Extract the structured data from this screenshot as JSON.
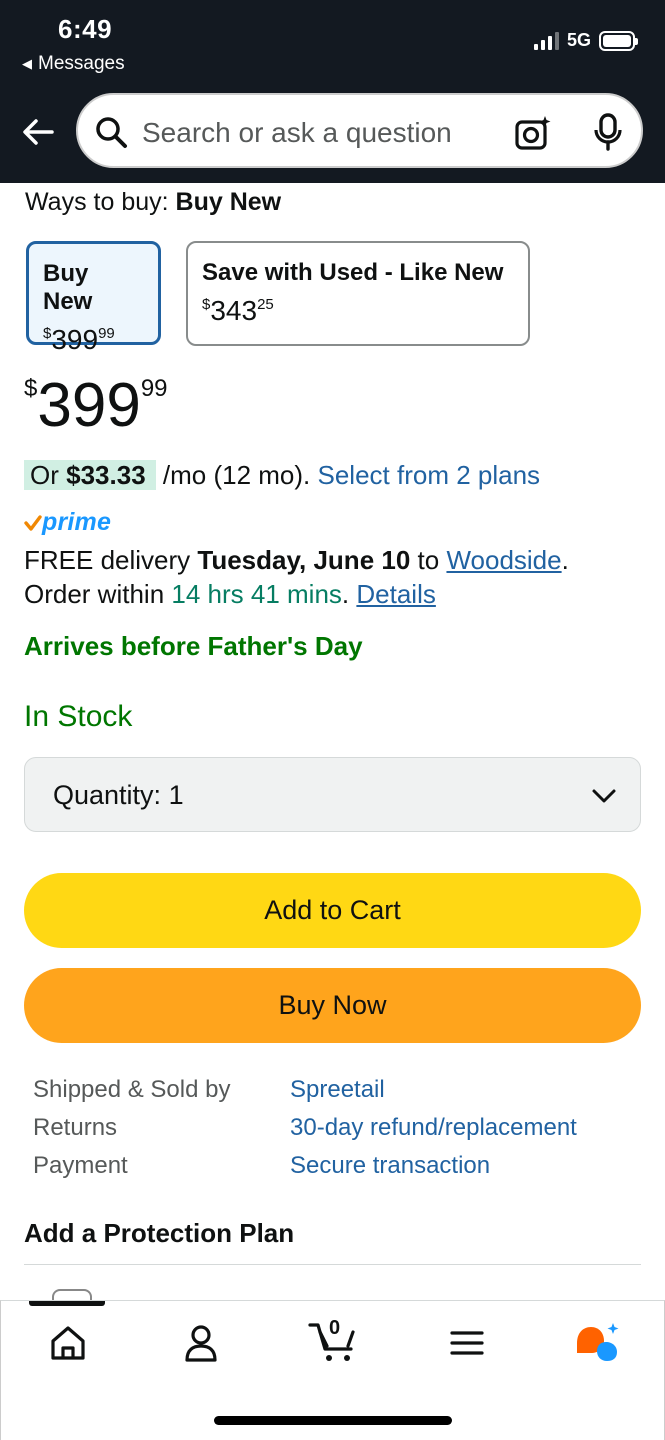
{
  "status_bar": {
    "time": "6:49",
    "back_app": "Messages",
    "network": "5G"
  },
  "search": {
    "placeholder": "Search or ask a question",
    "icons": [
      "back-arrow-icon",
      "search-icon",
      "camera-icon",
      "microphone-icon"
    ]
  },
  "ways_to_buy": {
    "label": "Ways to buy:",
    "selected": "Buy New",
    "options": [
      {
        "title": "Buy New",
        "currency": "$",
        "whole": "399",
        "fraction": "99",
        "selected": true
      },
      {
        "title": "Save with Used - Like New",
        "currency": "$",
        "whole": "343",
        "fraction": "25",
        "selected": false
      }
    ]
  },
  "price": {
    "currency": "$",
    "whole": "399",
    "fraction": "99"
  },
  "monthly": {
    "or": "Or",
    "amount": "$33.33",
    "term": "/mo (12 mo).",
    "plans_link": "Select from 2 plans"
  },
  "prime_label": "prime",
  "delivery": {
    "free": "FREE delivery",
    "date": "Tuesday, June 10",
    "to": "to",
    "location": "Woodside",
    "period": ".",
    "order_within": "Order within",
    "countdown": "14 hrs 41 mins",
    "details": "Details"
  },
  "arrives_note": "Arrives before Father's Day",
  "stock": "In Stock",
  "quantity": {
    "label": "Quantity:",
    "value": "1"
  },
  "buttons": {
    "add_to_cart": "Add to Cart",
    "buy_now": "Buy Now"
  },
  "seller_info": [
    {
      "label": "Shipped & Sold by",
      "value": "Spreetail"
    },
    {
      "label": "Returns",
      "value": "30-day refund/replacement"
    },
    {
      "label": "Payment",
      "value": "Secure transaction"
    }
  ],
  "protection_heading": "Add a Protection Plan",
  "bottom_nav": {
    "items": [
      "home-icon",
      "account-icon",
      "cart-icon",
      "menu-icon",
      "rufus-icon"
    ],
    "cart_count": "0"
  },
  "colors": {
    "header_bg": "#131921",
    "link": "#2162a1",
    "green": "#007600",
    "add_to_cart": "#ffd814",
    "buy_now": "#ffa41c",
    "selected_border": "#2162a1"
  }
}
